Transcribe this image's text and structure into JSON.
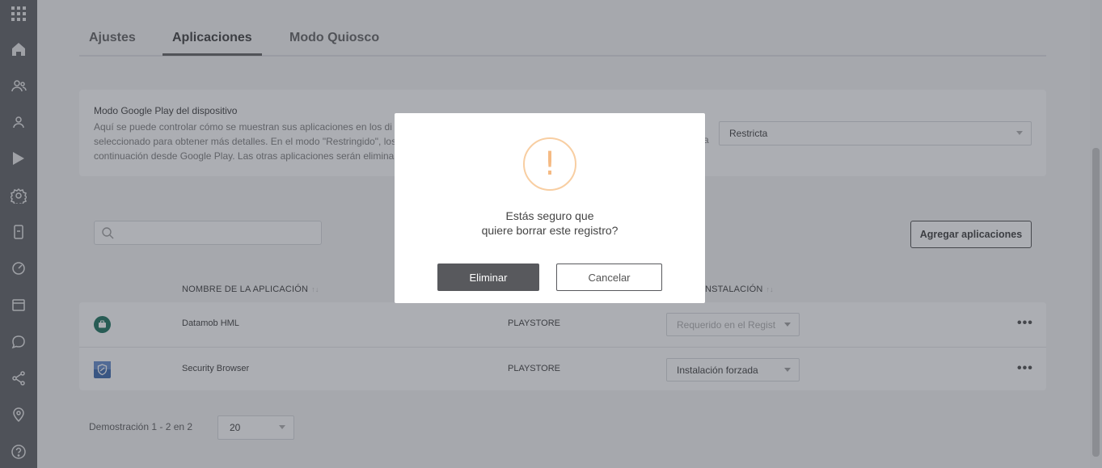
{
  "sidebar": {
    "icons": [
      "apps-grid-icon",
      "home-icon",
      "users-icon",
      "user-icon",
      "play-store-icon",
      "settings-icon",
      "device-icon",
      "dashboard-icon",
      "calendar-icon",
      "chat-icon",
      "share-icon",
      "location-icon",
      "help-icon"
    ]
  },
  "tabs": [
    {
      "label": "Ajustes",
      "active": false
    },
    {
      "label": "Aplicaciones",
      "active": true
    },
    {
      "label": "Modo Quiosco",
      "active": false
    }
  ],
  "google_play": {
    "title": "Modo Google Play del dispositivo",
    "desc_line1": "Aquí se puede controlar cómo se muestran sus aplicaciones en los di",
    "desc_line2": "seleccionado para obtener más detalles. En el modo \"Restringido\", los",
    "desc_line3": "continuación desde Google Play. Las otras aplicaciones serán elimina",
    "desc_tail": "a",
    "selected": "Restricta"
  },
  "search": {
    "placeholder": ""
  },
  "add_button": "Agregar aplicaciones",
  "table": {
    "headers": {
      "name": "NOMBRE DE LA APLICACIÓN",
      "install": "NSTALACIÓN",
      "sort_arrows": "↑↓"
    },
    "rows": [
      {
        "name": "Datamob HML",
        "source": "PLAYSTORE",
        "install": "Requerido en el Regist",
        "disabled": true,
        "icon": "briefcase-icon"
      },
      {
        "name": "Security Browser",
        "source": "PLAYSTORE",
        "install": "Instalación forzada",
        "disabled": false,
        "icon": "shield-browser-icon"
      }
    ],
    "more": "•••"
  },
  "pagination": {
    "label": "Demostración 1 - 2 en 2",
    "page_size": "20"
  },
  "modal": {
    "icon_glyph": "!",
    "line1": "Estás seguro que",
    "line2": "quiere borrar este registro?",
    "confirm": "Eliminar",
    "cancel": "Cancelar"
  },
  "colors": {
    "sidebar": "#56585c",
    "warning": "#f5ba83",
    "primary_button": "#58595d",
    "overlay": "rgba(72,76,86,0.45)"
  }
}
